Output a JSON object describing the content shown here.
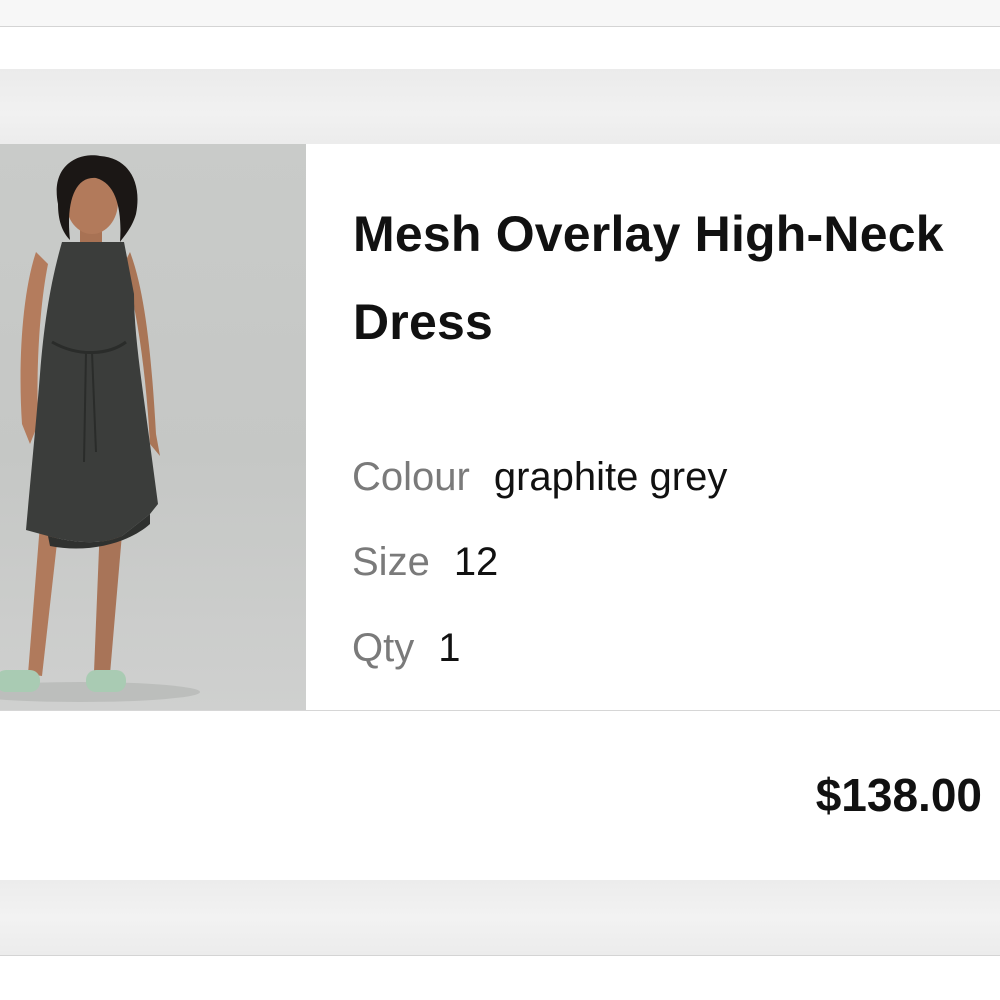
{
  "item": {
    "title": "Mesh Overlay High-Neck Dress",
    "image_icon": "product-photo-dress",
    "attributes": {
      "colour_label": "Colour",
      "colour_value": "graphite grey",
      "size_label": "Size",
      "size_value": "12",
      "qty_label": "Qty",
      "qty_value": "1"
    },
    "price": "$138.00"
  }
}
